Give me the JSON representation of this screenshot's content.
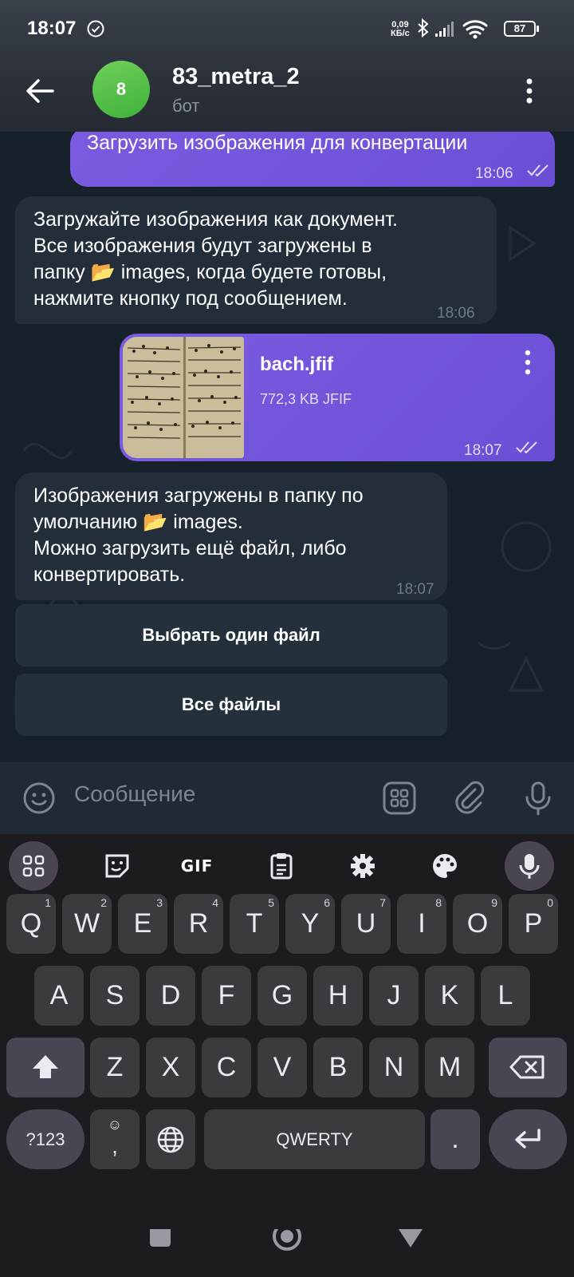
{
  "status": {
    "time": "18:07",
    "net_speed_value": "0,09",
    "net_speed_unit": "КБ/с",
    "battery": "87"
  },
  "header": {
    "avatar_letter": "8",
    "title": "83_metra_2",
    "subtitle": "бот"
  },
  "messages": [
    {
      "direction": "out",
      "text": "Загрузить изображения для конвертации",
      "time": "18:06"
    },
    {
      "direction": "in",
      "lines": [
        "Загружайте изображения как документ.",
        "Все изображения будут загружены в",
        "папку 📂 images, когда будете готовы,",
        "нажмите кнопку под сообщением."
      ],
      "time": "18:06"
    },
    {
      "direction": "out",
      "file_name": "bach.jfif",
      "file_meta": "772,3 KB JFIF",
      "time": "18:07"
    },
    {
      "direction": "in",
      "lines": [
        "Изображения загружены в папку  по",
        "умолчанию 📂 images.",
        "Можно загрузить ещё файл, либо",
        "конвертировать."
      ],
      "time": "18:07"
    }
  ],
  "inline_buttons": [
    "Выбрать один файл",
    "Все файлы"
  ],
  "input": {
    "placeholder": "Сообщение"
  },
  "keyboard": {
    "toolbar": [
      "apps-icon",
      "sticker-icon",
      "GIF",
      "clipboard-icon",
      "settings-icon",
      "palette-icon",
      "mic-icon"
    ],
    "row1": [
      [
        "Q",
        "1"
      ],
      [
        "W",
        "2"
      ],
      [
        "E",
        "3"
      ],
      [
        "R",
        "4"
      ],
      [
        "T",
        "5"
      ],
      [
        "Y",
        "6"
      ],
      [
        "U",
        "7"
      ],
      [
        "I",
        "8"
      ],
      [
        "O",
        "9"
      ],
      [
        "P",
        "0"
      ]
    ],
    "row2": [
      "A",
      "S",
      "D",
      "F",
      "G",
      "H",
      "J",
      "K",
      "L"
    ],
    "row3": [
      "Z",
      "X",
      "C",
      "V",
      "B",
      "N",
      "M"
    ],
    "symbols_key": "?123",
    "comma_key": ",",
    "space_key": "QWERTY",
    "period_key": "."
  }
}
